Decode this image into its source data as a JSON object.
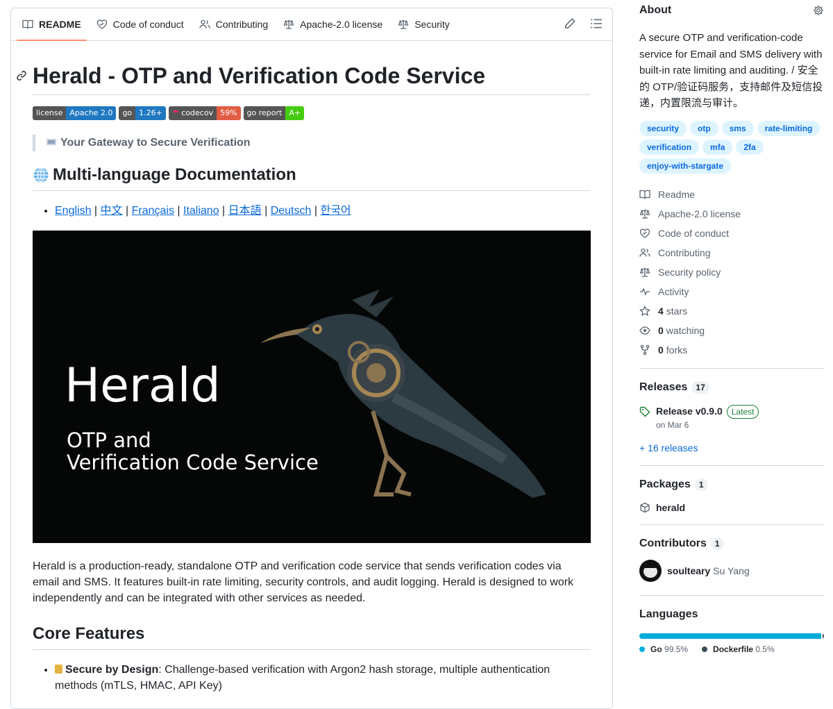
{
  "readme": {
    "tabs": [
      {
        "label": "README",
        "icon": "book-icon",
        "active": true
      },
      {
        "label": "Code of conduct",
        "icon": "code-of-conduct-icon"
      },
      {
        "label": "Contributing",
        "icon": "people-icon"
      },
      {
        "label": "Apache-2.0 license",
        "icon": "law-icon"
      },
      {
        "label": "Security",
        "icon": "law-icon"
      }
    ],
    "title": "Herald - OTP and Verification Code Service",
    "badges": [
      {
        "left": "license",
        "right": "Apache 2.0",
        "color": "#1f78c1"
      },
      {
        "left": "go",
        "right": "1.26+",
        "color": "#1f78c1"
      },
      {
        "left": "codecov",
        "right": "59%",
        "color": "#e05d44"
      },
      {
        "left": "go report",
        "right": "A+",
        "color": "#44cc11"
      }
    ],
    "tagline": "Your Gateway to Secure Verification",
    "multilang_heading": "Multi-language Documentation",
    "languages": [
      "English",
      "中文",
      "Français",
      "Italiano",
      "日本語",
      "Deutsch",
      "한국어"
    ],
    "hero": {
      "title": "Herald",
      "subtitle_line1": "OTP and",
      "subtitle_line2": "Verification Code Service"
    },
    "intro": "Herald is a production-ready, standalone OTP and verification code service that sends verification codes via email and SMS. It features built-in rate limiting, security controls, and audit logging. Herald is designed to work independently and can be integrated with other services as needed.",
    "core_heading": "Core Features",
    "feature1_title": "Secure by Design",
    "feature1_text": ": Challenge-based verification with Argon2 hash storage, multiple authentication methods (mTLS, HMAC, API Key)"
  },
  "sidebar": {
    "about_title": "About",
    "description": "A secure OTP and verification-code service for Email and SMS delivery with built-in rate limiting and auditing. / 安全的 OTP/验证码服务，支持邮件及短信投递，内置限流与审计。",
    "topics": [
      "security",
      "otp",
      "sms",
      "rate-limiting",
      "verification",
      "mfa",
      "2fa",
      "enjoy-with-stargate"
    ],
    "meta": [
      {
        "label": "Readme",
        "icon": "book-icon"
      },
      {
        "label": "Apache-2.0 license",
        "icon": "law-icon"
      },
      {
        "label": "Code of conduct",
        "icon": "code-of-conduct-icon"
      },
      {
        "label": "Contributing",
        "icon": "people-icon"
      },
      {
        "label": "Security policy",
        "icon": "law-icon"
      },
      {
        "label": "Activity",
        "icon": "pulse-icon"
      },
      {
        "count": "4",
        "label": "stars",
        "icon": "star-icon"
      },
      {
        "count": "0",
        "label": "watching",
        "icon": "eye-icon"
      },
      {
        "count": "0",
        "label": "forks",
        "icon": "fork-icon"
      }
    ],
    "releases": {
      "title": "Releases",
      "count": "17",
      "name": "Release v0.9.0",
      "latest": "Latest",
      "date": "on Mar 6",
      "more": "+ 16 releases"
    },
    "packages": {
      "title": "Packages",
      "count": "1",
      "name": "herald"
    },
    "contributors": {
      "title": "Contributors",
      "count": "1",
      "login": "soulteary",
      "name": "Su Yang"
    },
    "languages": {
      "title": "Languages",
      "items": [
        {
          "name": "Go",
          "pct": "99.5%",
          "color": "#00add8",
          "value": 99.5
        },
        {
          "name": "Dockerfile",
          "pct": "0.5%",
          "color": "#384d54",
          "value": 0.5
        }
      ]
    }
  }
}
